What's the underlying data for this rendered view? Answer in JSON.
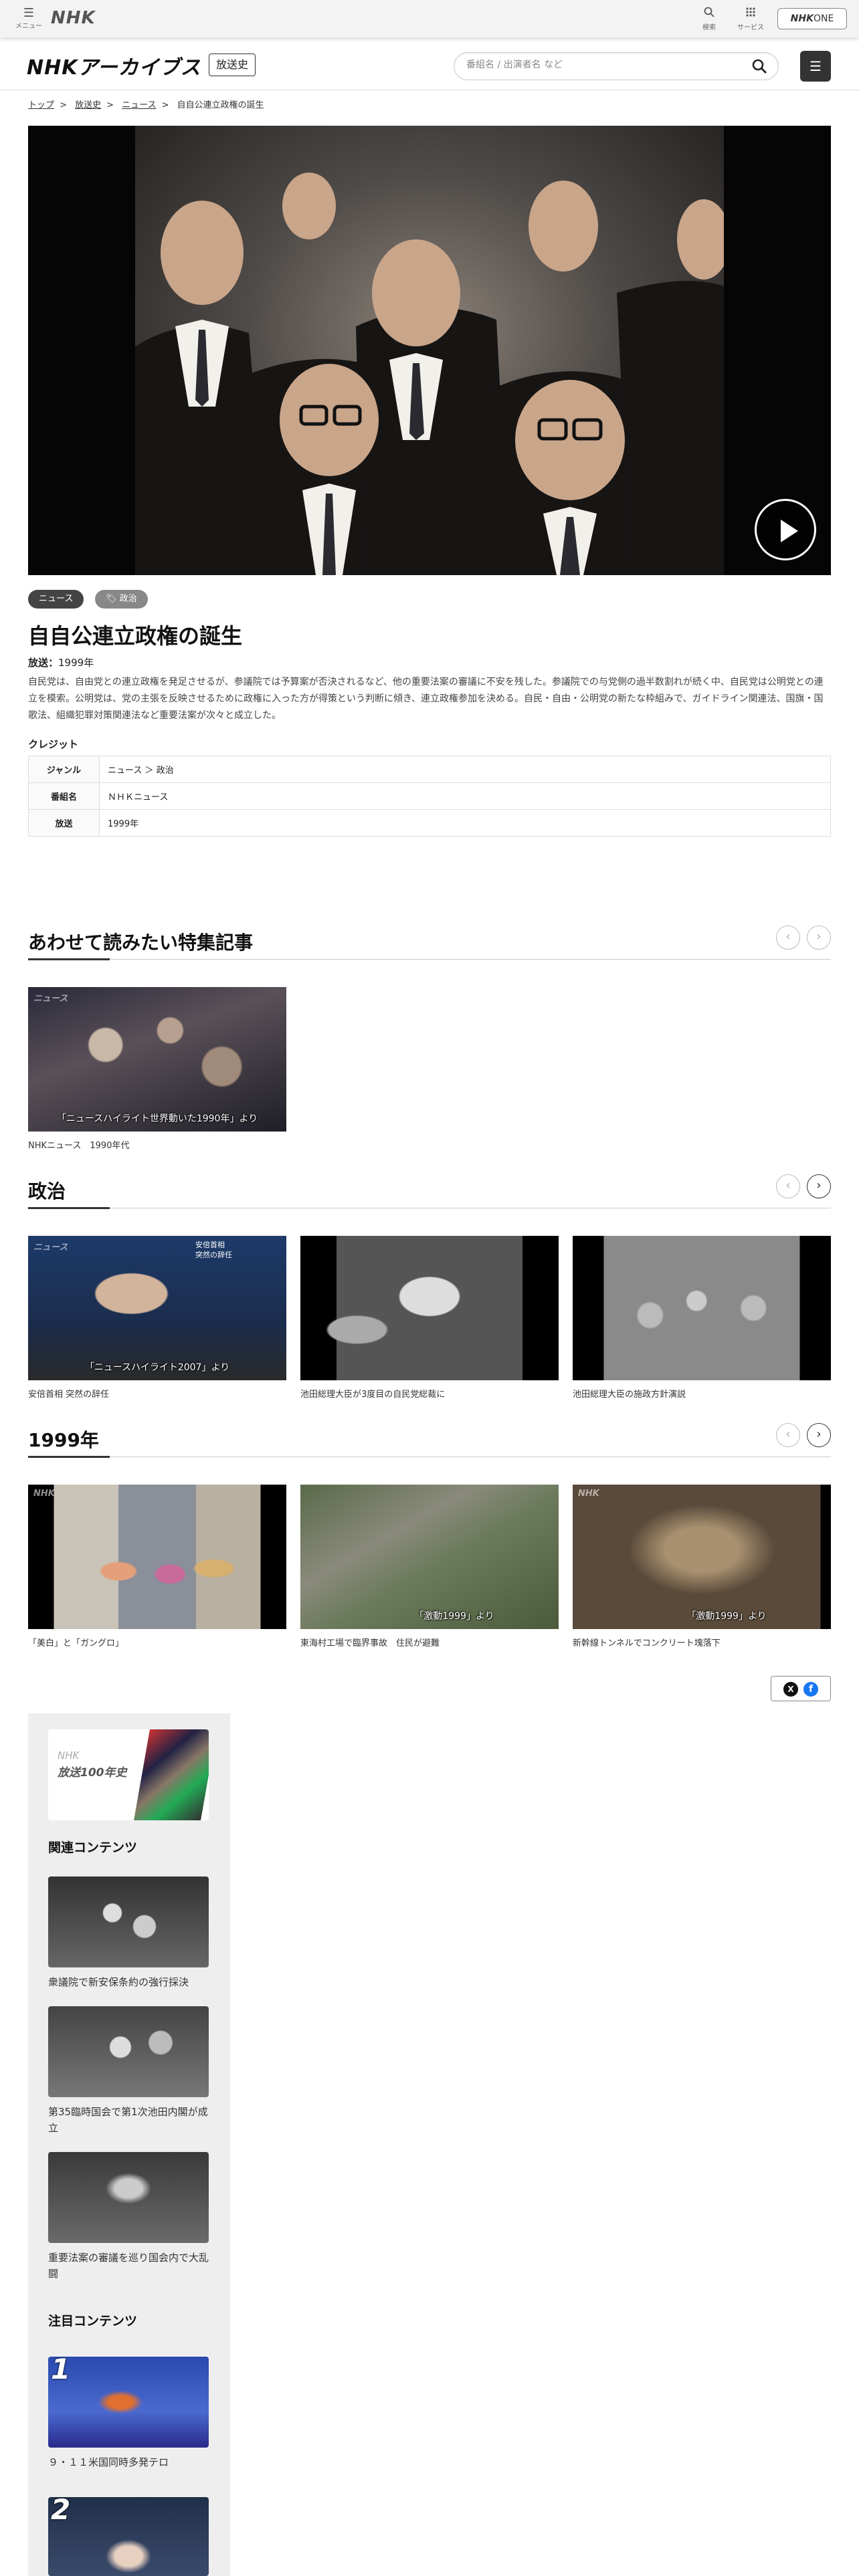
{
  "topbar": {
    "menu_label": "メニュー",
    "logo": "NHK",
    "search_label": "検索",
    "service_label": "サービス",
    "nhkone_brand": "NHK",
    "nhkone_suffix": "ONE"
  },
  "header": {
    "logo": "NHKアーカイブス",
    "category_tag": "放送史",
    "search_placeholder": "番組名 / 出演者名 など"
  },
  "breadcrumb": [
    "トップ",
    "放送史",
    "ニュース",
    "自自公連立政権の誕生"
  ],
  "video": {
    "play_label": "再生"
  },
  "article": {
    "tags": [
      "ニュース",
      "政治"
    ],
    "title": "自自公連立政権の誕生",
    "aired_label": "放送：",
    "aired_value": "1999年",
    "description": "自民党は、自由党との連立政権を発足させるが、参議院では予算案が否決されるなど、他の重要法案の審議に不安を残した。参議院での与党側の過半数割れが続く中、自民党は公明党との連立を模索。公明党は、党の主張を反映させるために政権に入った方が得策という判断に傾き、連立政権参加を決める。自民・自由・公明党の新たな枠組みで、ガイドライン関連法、国旗・国歌法、組織犯罪対策関連法など重要法案が次々と成立した。",
    "credit_heading": "クレジット",
    "credits": [
      {
        "key": "ジャンル",
        "value": "ニュース ＞ 政治"
      },
      {
        "key": "番組名",
        "value": "ＮＨＫニュース"
      },
      {
        "key": "放送",
        "value": "1999年"
      }
    ]
  },
  "sections": {
    "features": {
      "heading": "あわせて読みたい特集記事",
      "items": [
        {
          "thumb_caption": "「ニュースハイライト世界動いた1990年」より",
          "title": "NHKニュース　1990年代"
        }
      ]
    },
    "politics": {
      "heading": "政治",
      "items": [
        {
          "thumb_caption": "「ニュースハイライト2007」より",
          "overlay": "安倍首相\n突然の辞任",
          "title": "安倍首相 突然の辞任"
        },
        {
          "thumb_caption": "",
          "title": "池田総理大臣が3度目の自民党総裁に"
        },
        {
          "thumb_caption": "",
          "title": "池田総理大臣の施政方針演説"
        }
      ]
    },
    "year": {
      "heading": "1999年",
      "items": [
        {
          "thumb_caption": "",
          "corner": "NHK",
          "title": "「美白」と「ガングロ」"
        },
        {
          "thumb_caption": "「激動1999」より",
          "title": "東海村工場で臨界事故　住民が避難"
        },
        {
          "thumb_caption": "「激動1999」より",
          "title": "新幹線トンネルでコンクリート塊落下"
        }
      ]
    }
  },
  "share": {
    "x": "X",
    "facebook": "f"
  },
  "sidebar": {
    "banner_line1": "NHK",
    "banner_line2": "放送100年史",
    "related_heading": "関連コンテンツ",
    "related": [
      {
        "title": "衆議院で新安保条約の強行採決"
      },
      {
        "title": "第35臨時国会で第1次池田内閣が成立"
      },
      {
        "title": "重要法案の審議を巡り国会内で大乱闘"
      }
    ],
    "featured_heading": "注目コンテンツ",
    "featured": [
      {
        "rank": "1",
        "title": "９・１１米国同時多発テロ"
      },
      {
        "rank": "2",
        "title": ""
      }
    ]
  }
}
